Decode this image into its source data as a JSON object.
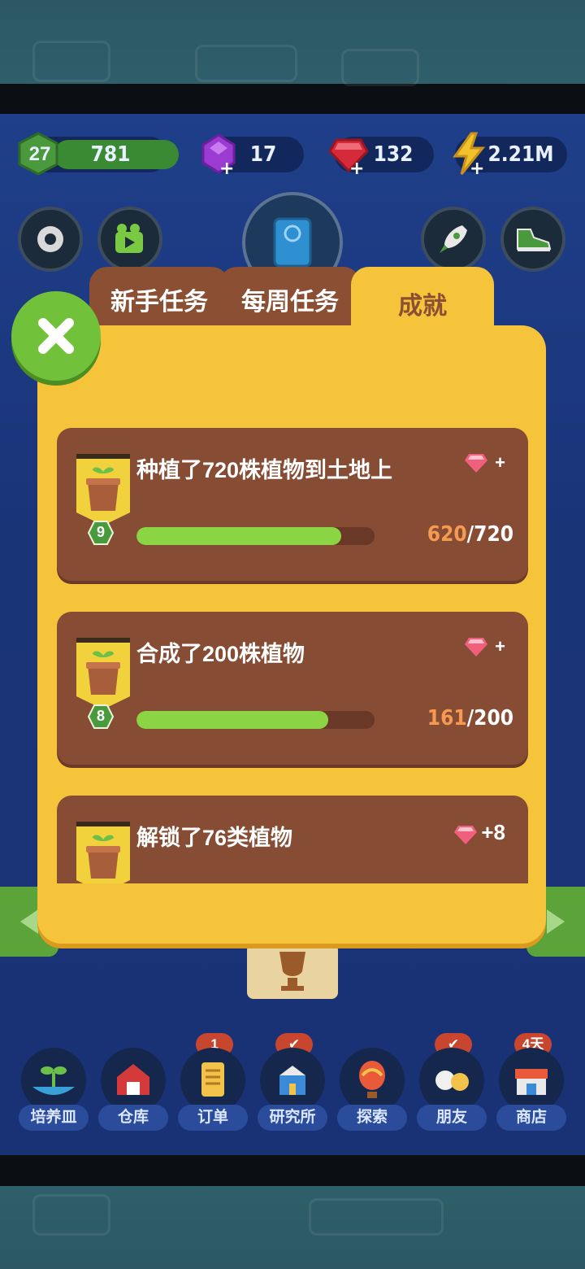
{
  "resources": {
    "level": "27",
    "coins": "781",
    "purple_gems": "17",
    "red_gems": "132",
    "energy": "2.21M"
  },
  "tabs": [
    {
      "label": "新手任务",
      "active": false
    },
    {
      "label": "每周任务",
      "active": false
    },
    {
      "label": "成就",
      "active": true
    }
  ],
  "achievements": [
    {
      "title": "种植了720株植物到土地上",
      "level": "9",
      "current": "620",
      "total": "/720",
      "progress": 0.861,
      "reward": "+"
    },
    {
      "title": "合成了200株植物",
      "level": "8",
      "current": "161",
      "total": "/200",
      "progress": 0.805,
      "reward": "+"
    },
    {
      "title": "解锁了76类植物",
      "reward": "+8"
    }
  ],
  "bottom_nav": [
    {
      "label": "培养皿",
      "icon": "sprout-icon"
    },
    {
      "label": "仓库",
      "icon": "barn-icon"
    },
    {
      "label": "订单",
      "icon": "scroll-icon",
      "badge": "1"
    },
    {
      "label": "研究所",
      "icon": "lab-icon",
      "badge": "✔"
    },
    {
      "label": "探索",
      "icon": "balloon-icon"
    },
    {
      "label": "朋友",
      "icon": "friends-icon",
      "badge": "✔"
    },
    {
      "label": "商店",
      "icon": "shop-icon",
      "badge": "4天"
    }
  ],
  "colors": {
    "panel": "#f6c43a",
    "card": "#874c34",
    "progress": "#8bd444",
    "current_count": "#f59a50"
  }
}
